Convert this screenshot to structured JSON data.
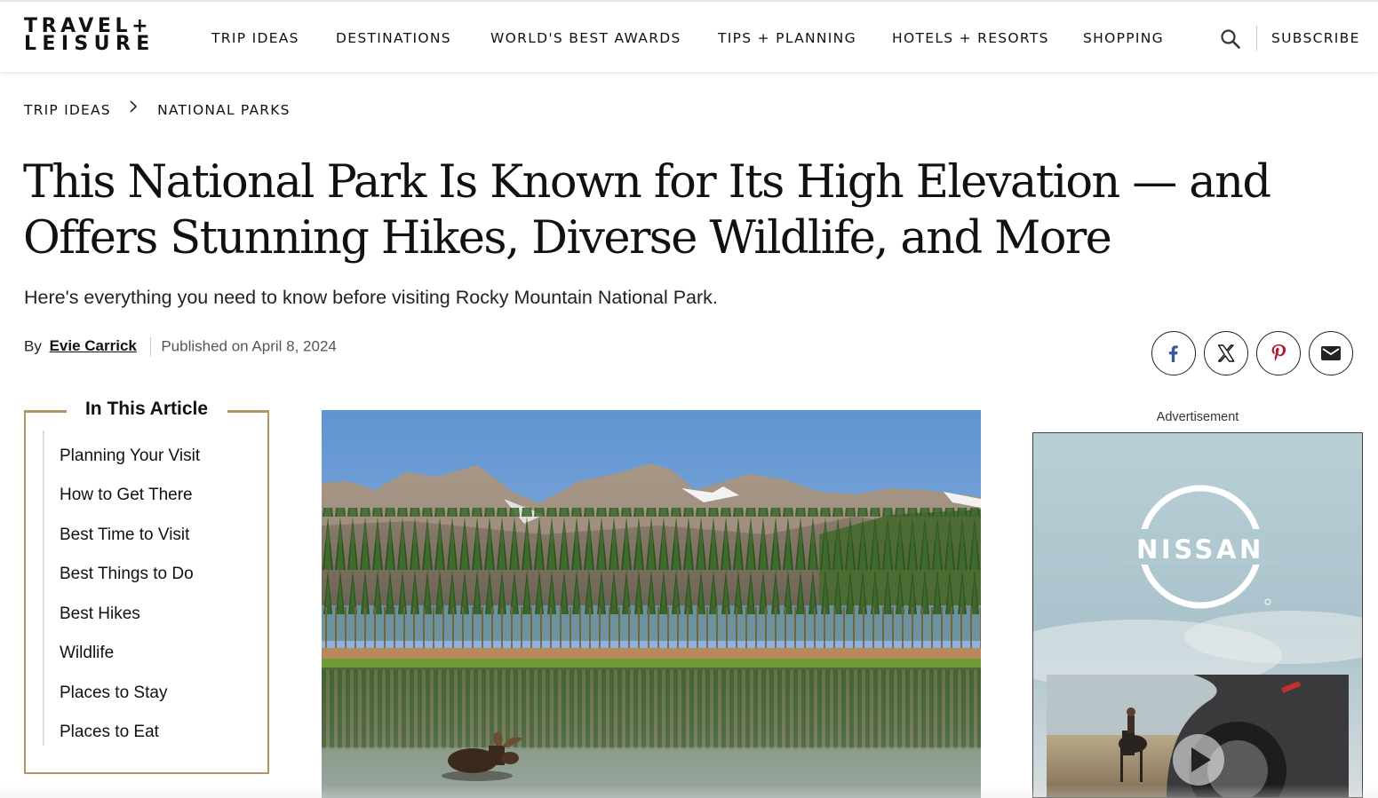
{
  "header": {
    "logo_line1": "TRAVEL+",
    "logo_line2": "LEISURE",
    "nav": [
      {
        "label": "TRIP IDEAS"
      },
      {
        "label": "DESTINATIONS"
      },
      {
        "label": "WORLD'S BEST AWARDS"
      },
      {
        "label": "TIPS + PLANNING"
      },
      {
        "label": "HOTELS + RESORTS"
      },
      {
        "label": "SHOPPING"
      }
    ],
    "subscribe_label": "SUBSCRIBE",
    "search_icon": "search-icon"
  },
  "breadcrumb": {
    "items": [
      "TRIP IDEAS",
      "NATIONAL PARKS"
    ]
  },
  "article": {
    "title": "This National Park Is Known for Its High Elevation — and Offers Stunning Hikes, Diverse Wildlife, and More",
    "subtitle": "Here's everything you need to know before visiting Rocky Mountain National Park.",
    "by_label": "By",
    "author": "Evie Carrick",
    "published": "Published on April 8, 2024"
  },
  "share": [
    {
      "icon": "facebook-icon"
    },
    {
      "icon": "x-icon"
    },
    {
      "icon": "pinterest-icon"
    },
    {
      "icon": "email-icon"
    }
  ],
  "toc": {
    "title": "In This Article",
    "items": [
      "Planning Your Visit",
      "How to Get There",
      "Best Time to Visit",
      "Best Things to Do",
      "Best Hikes",
      "Wildlife",
      "Places to Stay",
      "Places to Eat"
    ]
  },
  "ad": {
    "label": "Advertisement",
    "brand": "NISSAN"
  },
  "colors": {
    "accent_gold": "#b39464",
    "text": "#111111"
  }
}
